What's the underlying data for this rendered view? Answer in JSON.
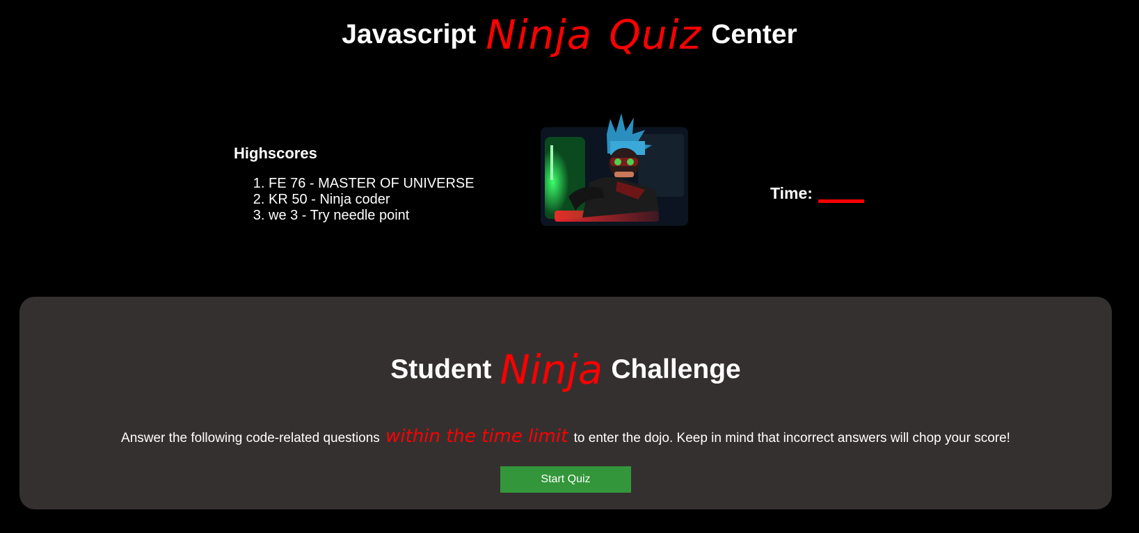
{
  "header": {
    "prefix": "Javascript",
    "highlight_1": "Ninja",
    "highlight_2": "Quiz",
    "suffix": "Center"
  },
  "highscores": {
    "title": "Highscores",
    "entries": [
      "FE 76 - MASTER OF UNIVERSE",
      "KR 50 - Ninja coder",
      "we 3 - Try needle point"
    ]
  },
  "timer": {
    "label": "Time:",
    "value": ""
  },
  "challenge": {
    "title_prefix": "Student",
    "title_highlight": "Ninja",
    "title_suffix": "Challenge",
    "desc_before": "Answer the following code-related questions",
    "desc_highlight": "within the time limit",
    "desc_after": "to enter the dojo. Keep in mind that incorrect answers will chop your score!",
    "start_label": "Start Quiz"
  },
  "colors": {
    "accent": "#ff0000",
    "panel": "#353030",
    "button": "#33963a",
    "background": "#000000"
  }
}
